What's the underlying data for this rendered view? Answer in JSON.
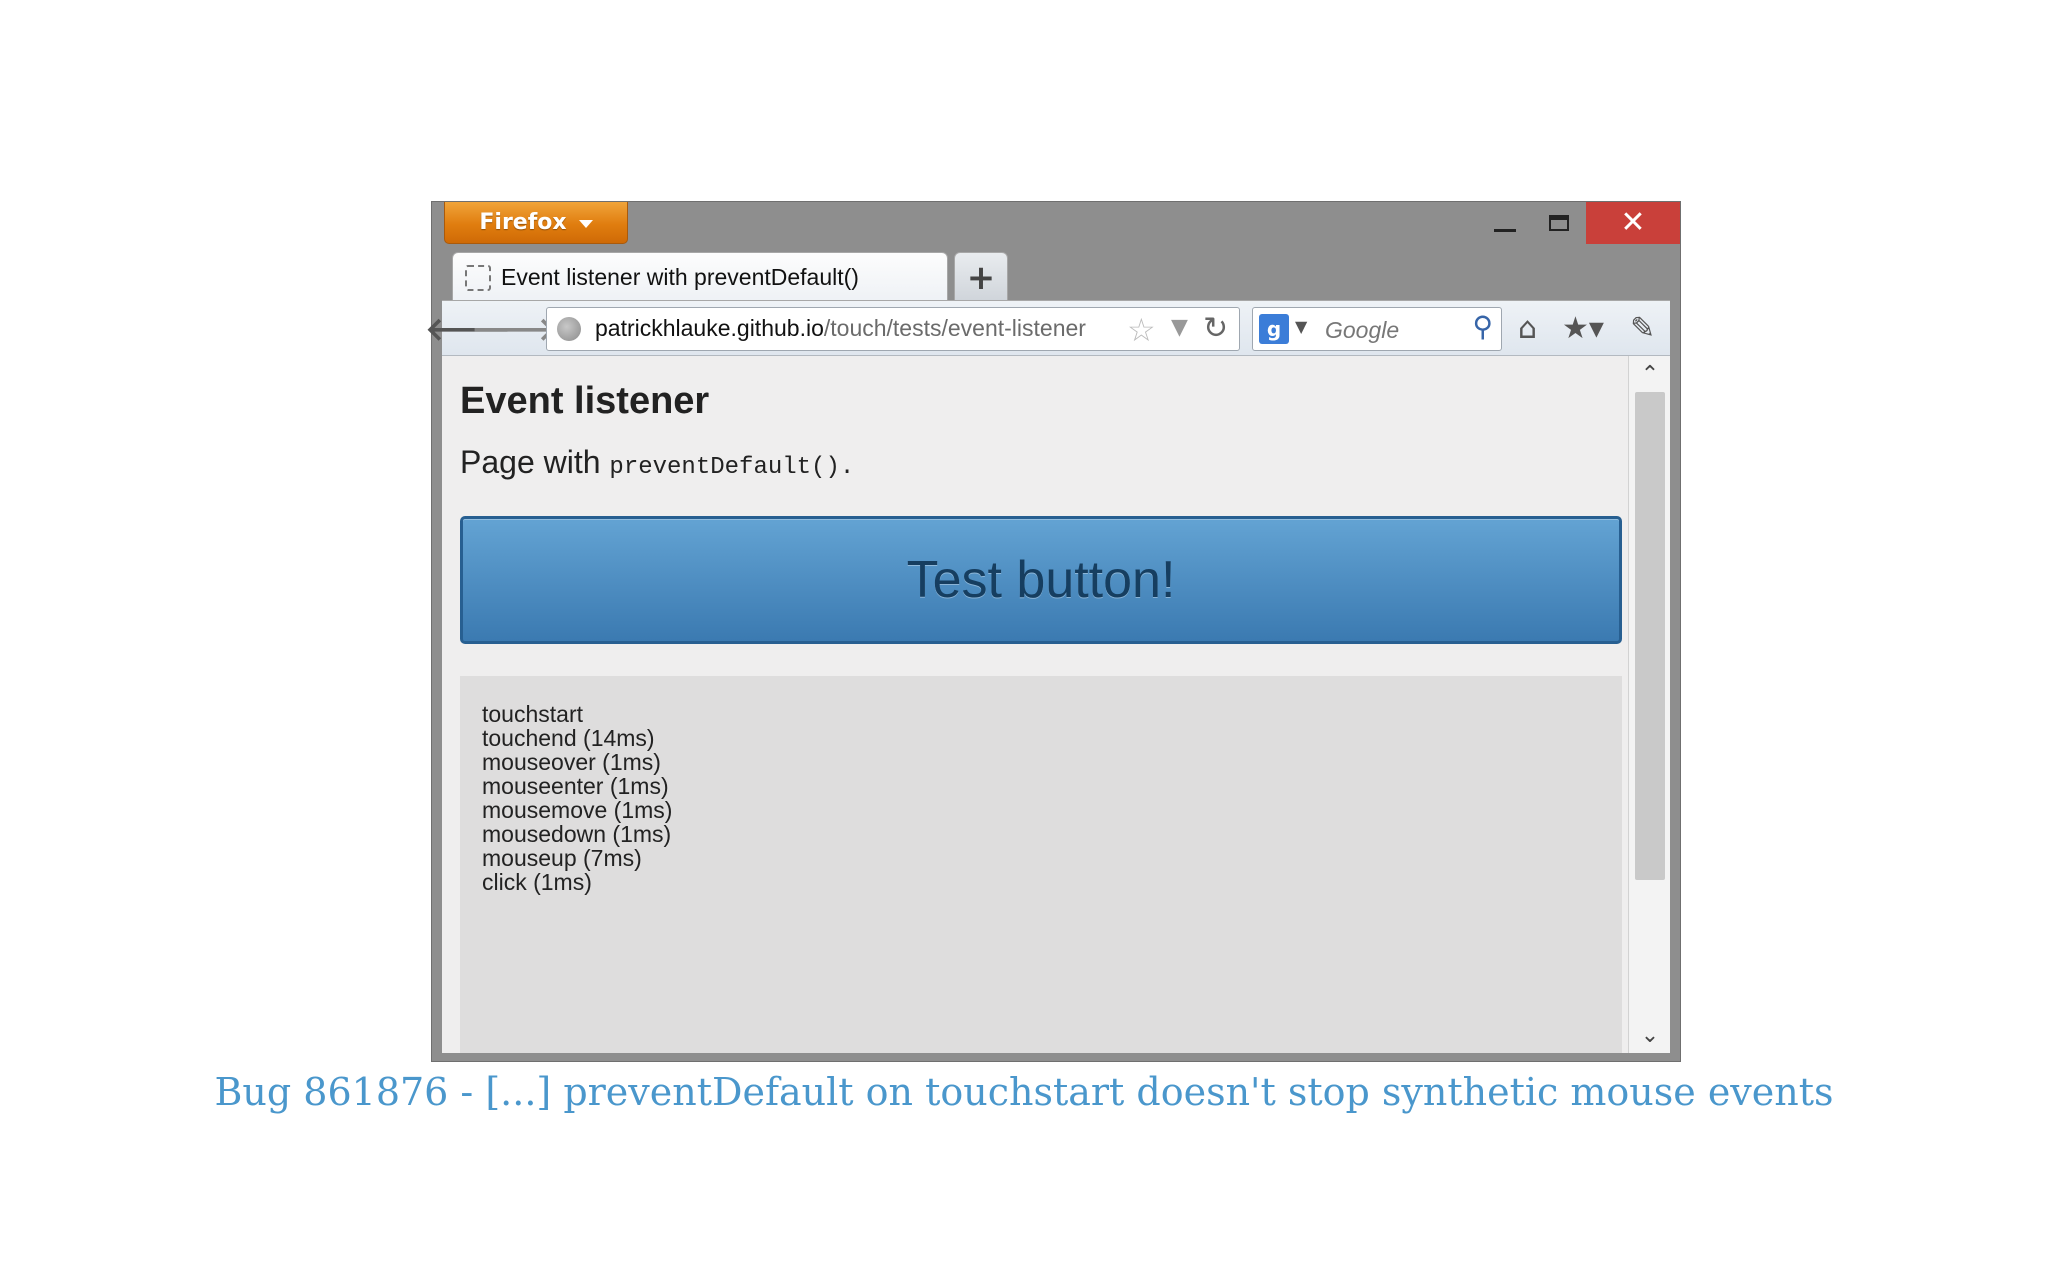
{
  "window": {
    "menu_button_label": "Firefox",
    "close_glyph": "✕"
  },
  "tab": {
    "title": "Event listener with preventDefault()",
    "new_tab_glyph": "+"
  },
  "navbar": {
    "back_glyph": "🡐",
    "forward_glyph": "🡒",
    "url_host": "patrickhlauke.github.io",
    "url_path": "/touch/tests/event-listener",
    "search_engine_letter": "g",
    "search_placeholder": "Google"
  },
  "page": {
    "heading": "Event listener",
    "para_prefix": "Page with ",
    "para_code": "preventDefault()",
    "para_suffix": ".",
    "button_label": "Test button!",
    "log": [
      "touchstart",
      "touchend (14ms)",
      "mouseover (1ms)",
      "mouseenter (1ms)",
      "mousemove (1ms)",
      "mousedown (1ms)",
      "mouseup (7ms)",
      "click (1ms)"
    ]
  },
  "caption": "Bug 861876 - [...] preventDefault on touchstart doesn't stop synthetic mouse events",
  "colors": {
    "firefox_orange": "#e07d0f",
    "close_red": "#c9403a",
    "button_blue": "#4f8fc4",
    "caption_blue": "#4a97cc"
  },
  "icons": [
    "globe-icon",
    "star-icon",
    "reload-icon",
    "google-icon",
    "search-icon",
    "home-icon",
    "bookmarks-icon",
    "tools-icon"
  ]
}
